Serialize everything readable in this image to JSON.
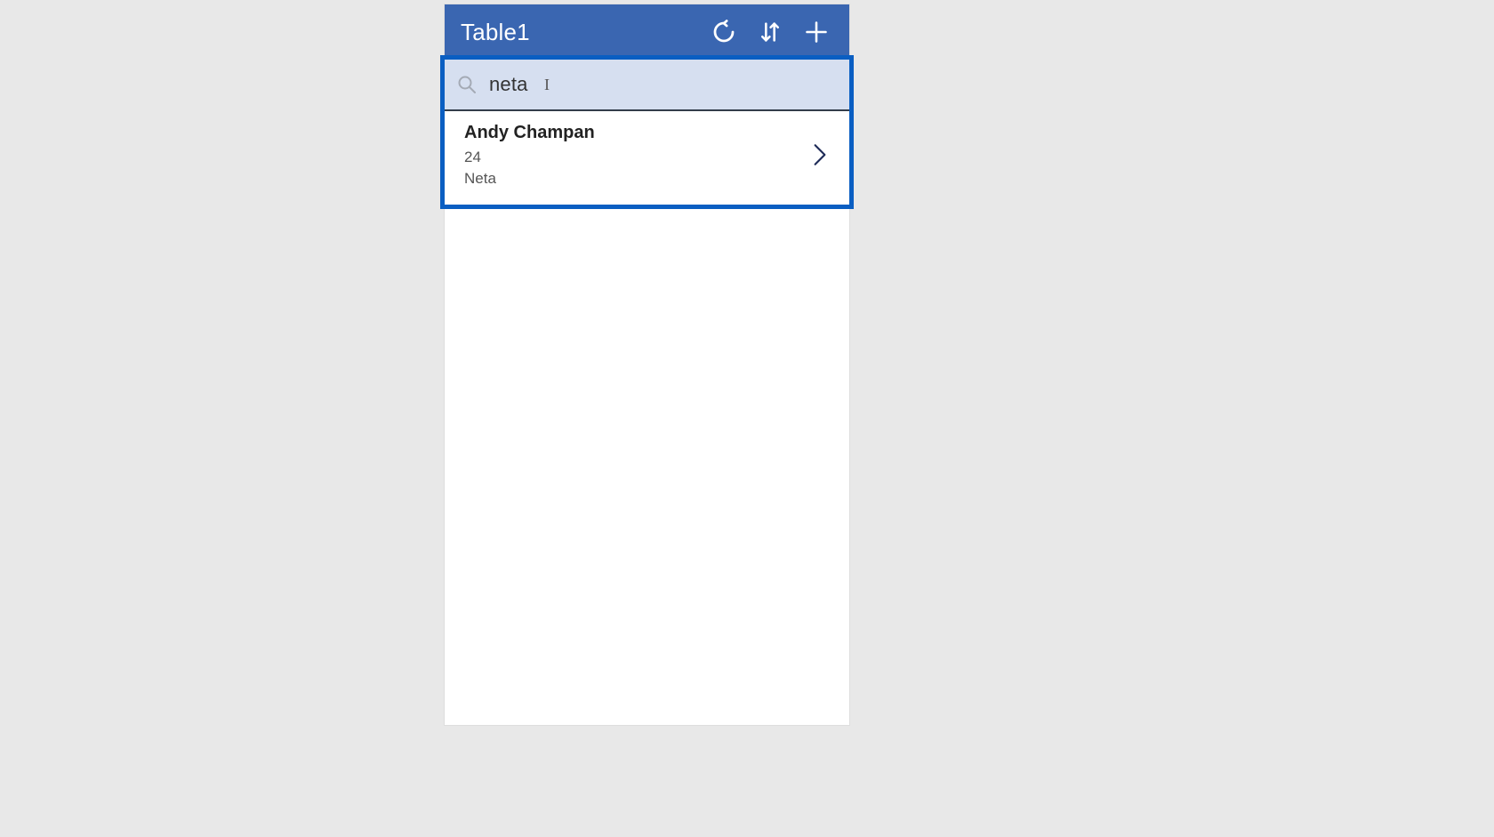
{
  "header": {
    "title": "Table1",
    "icons": {
      "refresh": "refresh-icon",
      "sort": "sort-icon",
      "add": "plus-icon"
    }
  },
  "search": {
    "value": "neta",
    "placeholder": ""
  },
  "results": [
    {
      "title": "Andy Champan",
      "line2": "24",
      "line3": "Neta"
    }
  ],
  "colors": {
    "accent": "#3a66b1",
    "highlight": "#0a5ec2",
    "searchBg": "#d6dff0"
  }
}
